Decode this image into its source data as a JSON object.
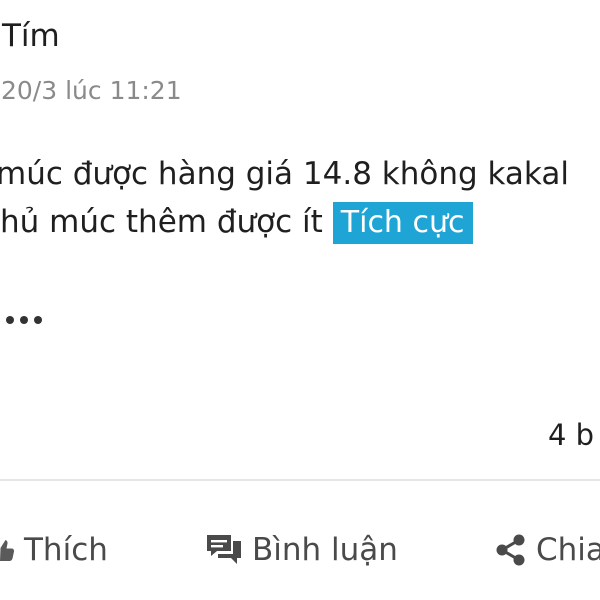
{
  "post": {
    "author": "Tím",
    "timestamp": "20/3 lúc 11:21",
    "content_line1": "múc được hàng giá 14.8 không kakal",
    "content_line2": "hủ múc thêm được ít",
    "sentiment_tag": "Tích cực",
    "comment_count": "4 b"
  },
  "actions": {
    "like_label": "Thích",
    "comment_label": "Bình luận",
    "share_label": "Chia"
  },
  "colors": {
    "tag_background": "#1ea5d6",
    "muted_text": "#8a8a8a",
    "action_text": "#4a4a4a"
  },
  "icons": {
    "like": "like-icon",
    "comment": "comment-icon",
    "share": "share-icon",
    "more": "more-icon"
  }
}
